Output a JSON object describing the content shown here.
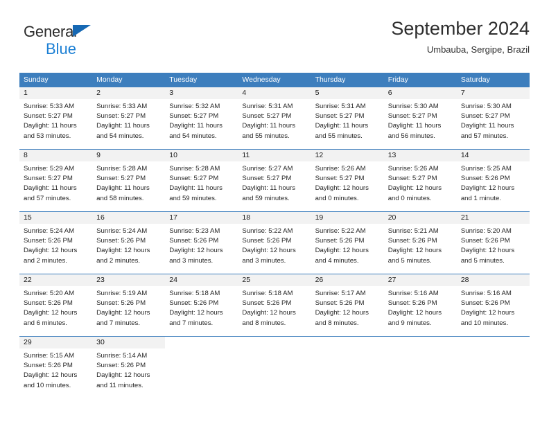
{
  "brand": {
    "name_part1": "General",
    "name_part2": "Blue",
    "triangle_color": "#1668b3",
    "blue_text_color": "#1b7fd4"
  },
  "header": {
    "title": "September 2024",
    "subtitle": "Umbauba, Sergipe, Brazil"
  },
  "theme": {
    "header_row_bg": "#3d7ebd",
    "header_row_text": "#ffffff",
    "daynum_bg": "#f2f2f2",
    "grid_line": "#3d7ebd"
  },
  "weekdays": [
    {
      "label": "Sunday"
    },
    {
      "label": "Monday"
    },
    {
      "label": "Tuesday"
    },
    {
      "label": "Wednesday"
    },
    {
      "label": "Thursday"
    },
    {
      "label": "Friday"
    },
    {
      "label": "Saturday"
    }
  ],
  "weeks": [
    {
      "days": [
        {
          "num": "1",
          "sunrise": "Sunrise: 5:33 AM",
          "sunset": "Sunset: 5:27 PM",
          "daylight": "Daylight: 11 hours and 53 minutes."
        },
        {
          "num": "2",
          "sunrise": "Sunrise: 5:33 AM",
          "sunset": "Sunset: 5:27 PM",
          "daylight": "Daylight: 11 hours and 54 minutes."
        },
        {
          "num": "3",
          "sunrise": "Sunrise: 5:32 AM",
          "sunset": "Sunset: 5:27 PM",
          "daylight": "Daylight: 11 hours and 54 minutes."
        },
        {
          "num": "4",
          "sunrise": "Sunrise: 5:31 AM",
          "sunset": "Sunset: 5:27 PM",
          "daylight": "Daylight: 11 hours and 55 minutes."
        },
        {
          "num": "5",
          "sunrise": "Sunrise: 5:31 AM",
          "sunset": "Sunset: 5:27 PM",
          "daylight": "Daylight: 11 hours and 55 minutes."
        },
        {
          "num": "6",
          "sunrise": "Sunrise: 5:30 AM",
          "sunset": "Sunset: 5:27 PM",
          "daylight": "Daylight: 11 hours and 56 minutes."
        },
        {
          "num": "7",
          "sunrise": "Sunrise: 5:30 AM",
          "sunset": "Sunset: 5:27 PM",
          "daylight": "Daylight: 11 hours and 57 minutes."
        }
      ]
    },
    {
      "days": [
        {
          "num": "8",
          "sunrise": "Sunrise: 5:29 AM",
          "sunset": "Sunset: 5:27 PM",
          "daylight": "Daylight: 11 hours and 57 minutes."
        },
        {
          "num": "9",
          "sunrise": "Sunrise: 5:28 AM",
          "sunset": "Sunset: 5:27 PM",
          "daylight": "Daylight: 11 hours and 58 minutes."
        },
        {
          "num": "10",
          "sunrise": "Sunrise: 5:28 AM",
          "sunset": "Sunset: 5:27 PM",
          "daylight": "Daylight: 11 hours and 59 minutes."
        },
        {
          "num": "11",
          "sunrise": "Sunrise: 5:27 AM",
          "sunset": "Sunset: 5:27 PM",
          "daylight": "Daylight: 11 hours and 59 minutes."
        },
        {
          "num": "12",
          "sunrise": "Sunrise: 5:26 AM",
          "sunset": "Sunset: 5:27 PM",
          "daylight": "Daylight: 12 hours and 0 minutes."
        },
        {
          "num": "13",
          "sunrise": "Sunrise: 5:26 AM",
          "sunset": "Sunset: 5:27 PM",
          "daylight": "Daylight: 12 hours and 0 minutes."
        },
        {
          "num": "14",
          "sunrise": "Sunrise: 5:25 AM",
          "sunset": "Sunset: 5:26 PM",
          "daylight": "Daylight: 12 hours and 1 minute."
        }
      ]
    },
    {
      "days": [
        {
          "num": "15",
          "sunrise": "Sunrise: 5:24 AM",
          "sunset": "Sunset: 5:26 PM",
          "daylight": "Daylight: 12 hours and 2 minutes."
        },
        {
          "num": "16",
          "sunrise": "Sunrise: 5:24 AM",
          "sunset": "Sunset: 5:26 PM",
          "daylight": "Daylight: 12 hours and 2 minutes."
        },
        {
          "num": "17",
          "sunrise": "Sunrise: 5:23 AM",
          "sunset": "Sunset: 5:26 PM",
          "daylight": "Daylight: 12 hours and 3 minutes."
        },
        {
          "num": "18",
          "sunrise": "Sunrise: 5:22 AM",
          "sunset": "Sunset: 5:26 PM",
          "daylight": "Daylight: 12 hours and 3 minutes."
        },
        {
          "num": "19",
          "sunrise": "Sunrise: 5:22 AM",
          "sunset": "Sunset: 5:26 PM",
          "daylight": "Daylight: 12 hours and 4 minutes."
        },
        {
          "num": "20",
          "sunrise": "Sunrise: 5:21 AM",
          "sunset": "Sunset: 5:26 PM",
          "daylight": "Daylight: 12 hours and 5 minutes."
        },
        {
          "num": "21",
          "sunrise": "Sunrise: 5:20 AM",
          "sunset": "Sunset: 5:26 PM",
          "daylight": "Daylight: 12 hours and 5 minutes."
        }
      ]
    },
    {
      "days": [
        {
          "num": "22",
          "sunrise": "Sunrise: 5:20 AM",
          "sunset": "Sunset: 5:26 PM",
          "daylight": "Daylight: 12 hours and 6 minutes."
        },
        {
          "num": "23",
          "sunrise": "Sunrise: 5:19 AM",
          "sunset": "Sunset: 5:26 PM",
          "daylight": "Daylight: 12 hours and 7 minutes."
        },
        {
          "num": "24",
          "sunrise": "Sunrise: 5:18 AM",
          "sunset": "Sunset: 5:26 PM",
          "daylight": "Daylight: 12 hours and 7 minutes."
        },
        {
          "num": "25",
          "sunrise": "Sunrise: 5:18 AM",
          "sunset": "Sunset: 5:26 PM",
          "daylight": "Daylight: 12 hours and 8 minutes."
        },
        {
          "num": "26",
          "sunrise": "Sunrise: 5:17 AM",
          "sunset": "Sunset: 5:26 PM",
          "daylight": "Daylight: 12 hours and 8 minutes."
        },
        {
          "num": "27",
          "sunrise": "Sunrise: 5:16 AM",
          "sunset": "Sunset: 5:26 PM",
          "daylight": "Daylight: 12 hours and 9 minutes."
        },
        {
          "num": "28",
          "sunrise": "Sunrise: 5:16 AM",
          "sunset": "Sunset: 5:26 PM",
          "daylight": "Daylight: 12 hours and 10 minutes."
        }
      ]
    },
    {
      "days": [
        {
          "num": "29",
          "sunrise": "Sunrise: 5:15 AM",
          "sunset": "Sunset: 5:26 PM",
          "daylight": "Daylight: 12 hours and 10 minutes."
        },
        {
          "num": "30",
          "sunrise": "Sunrise: 5:14 AM",
          "sunset": "Sunset: 5:26 PM",
          "daylight": "Daylight: 12 hours and 11 minutes."
        },
        {
          "num": "",
          "sunrise": "",
          "sunset": "",
          "daylight": ""
        },
        {
          "num": "",
          "sunrise": "",
          "sunset": "",
          "daylight": ""
        },
        {
          "num": "",
          "sunrise": "",
          "sunset": "",
          "daylight": ""
        },
        {
          "num": "",
          "sunrise": "",
          "sunset": "",
          "daylight": ""
        },
        {
          "num": "",
          "sunrise": "",
          "sunset": "",
          "daylight": ""
        }
      ]
    }
  ]
}
